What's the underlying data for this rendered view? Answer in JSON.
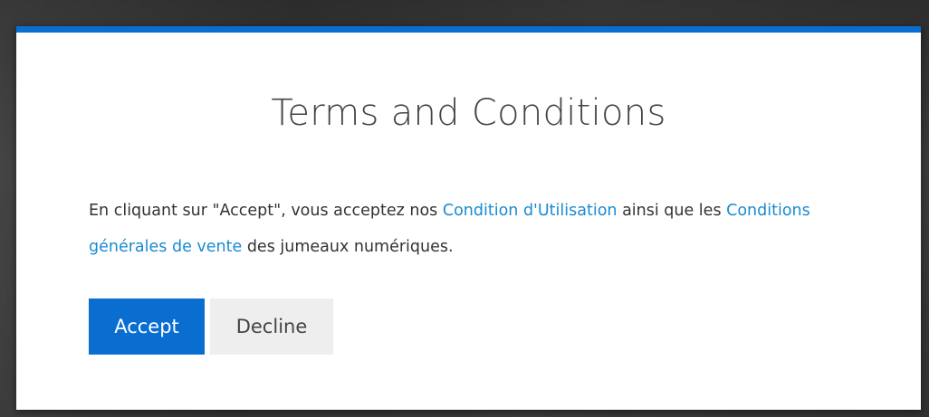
{
  "dialog": {
    "title": "Terms and Conditions",
    "body": {
      "text_before_link1": "En cliquant sur \"Accept\", vous acceptez nos ",
      "link1": "Condition d'Utilisation",
      "text_between": " ainsi que les ",
      "link2": "Conditions générales de vente",
      "text_after": " des jumeaux numériques."
    },
    "buttons": {
      "accept": "Accept",
      "decline": "Decline"
    }
  },
  "colors": {
    "accent": "#0a6ed1",
    "link": "#1a8bd0",
    "title": "#444444",
    "body_text": "#333333",
    "decline_bg": "#eeeeee",
    "backdrop": "#333333"
  }
}
